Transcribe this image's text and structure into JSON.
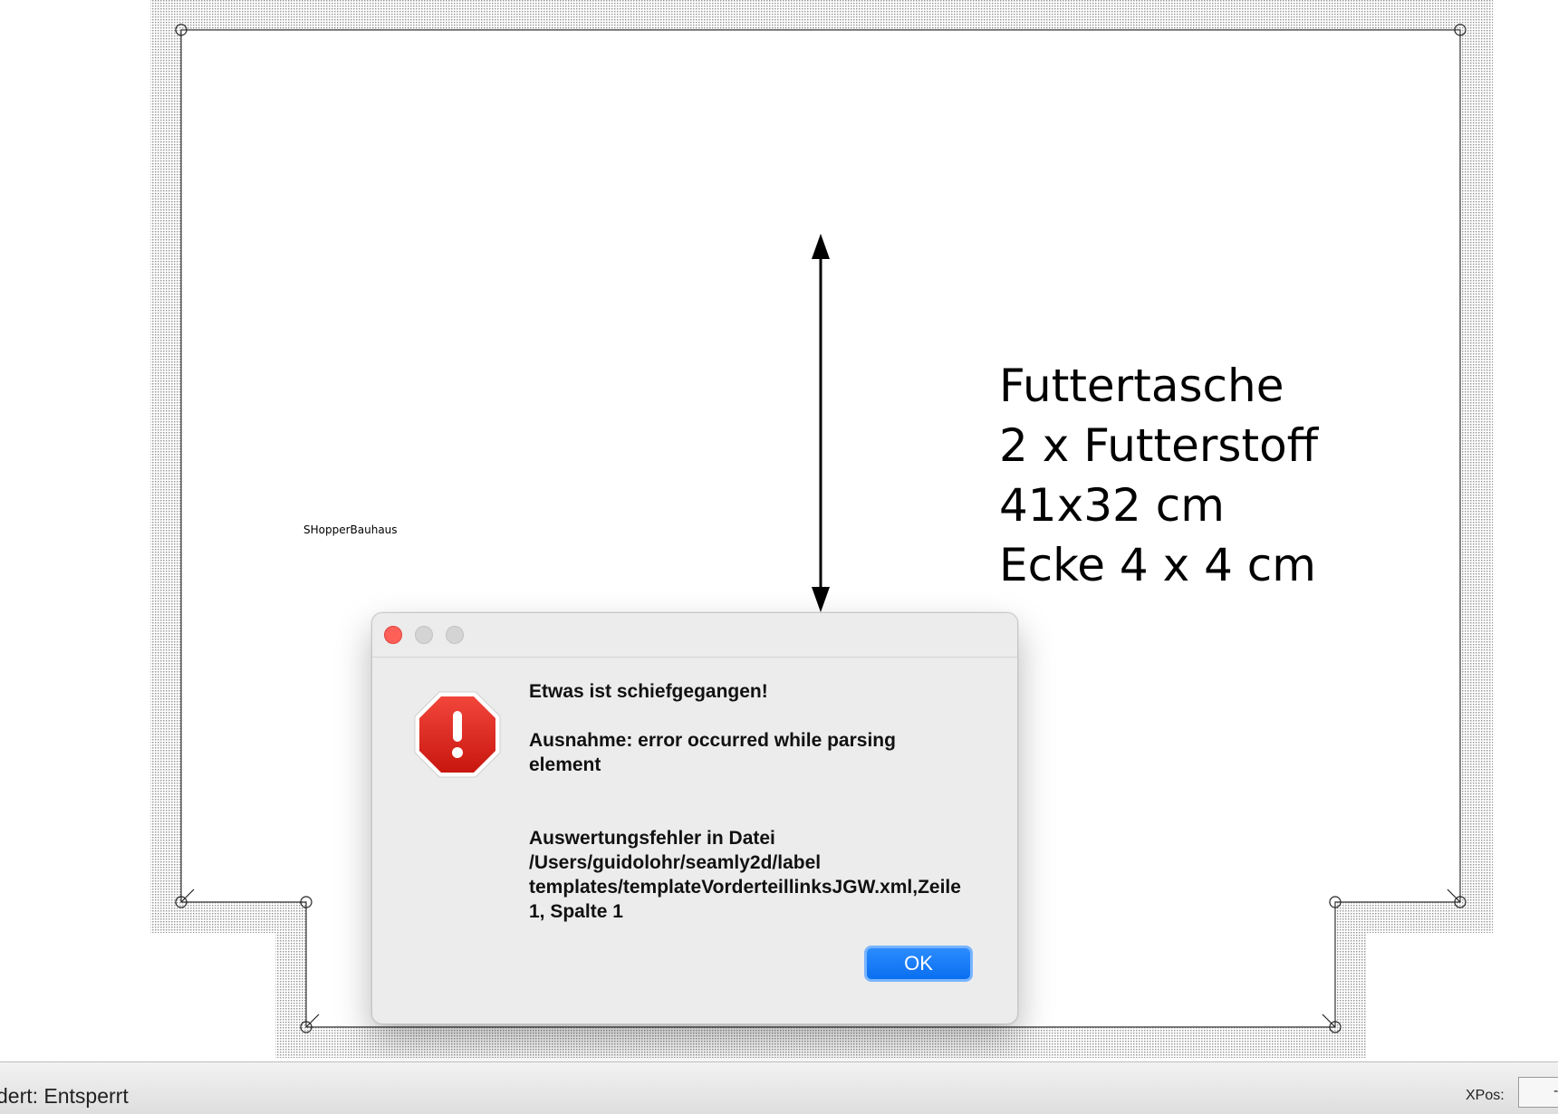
{
  "canvas": {
    "piece_label_lines": [
      "Futtertasche",
      "2 x Futterstoff",
      "41x32 cm",
      "Ecke 4 x 4 cm"
    ],
    "small_label": "SHopperBauhaus"
  },
  "dialog": {
    "heading": "Etwas ist schiefgegangen!",
    "exception": "Ausnahme: error occurred while parsing element",
    "details": "Auswertungsfehler in Datei /Users/guidolohr/seamly2d/label templates/templateVorderteillinksJGW.xml,Zeile 1, Spalte 1",
    "ok_label": "OK",
    "icon": "stop-alert-icon"
  },
  "statusbar": {
    "text": "dert: Entsperrt",
    "xpos_label": "XPos:",
    "xpos_value": "-"
  },
  "colors": {
    "close_button": "#fe5f57",
    "ok_button": "#0a6ff0",
    "stop_icon": "#d9261c"
  }
}
